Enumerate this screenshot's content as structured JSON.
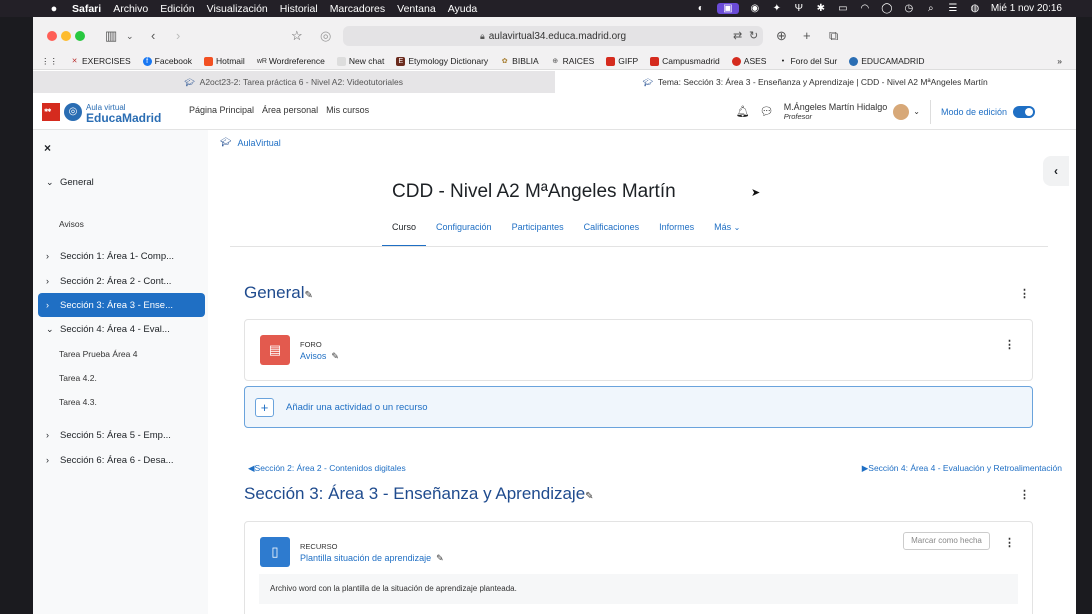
{
  "menubar": {
    "apple": "",
    "items": [
      "Safari",
      "Archivo",
      "Edición",
      "Visualización",
      "Historial",
      "Marcadores",
      "Ventana",
      "Ayuda"
    ],
    "clock": "Mié 1 nov 20:16"
  },
  "browser": {
    "url": "aulavirtual34.educa.madrid.org",
    "bookmarks": [
      "EXERCISES",
      "Facebook",
      "Hotmail",
      "Wordreference",
      "New chat",
      "Etymology Dictionary",
      "BIBLIA",
      "RAICES",
      "GIFP",
      "Campusmadrid",
      "ASES",
      "Foro del Sur",
      "EDUCAMADRID"
    ],
    "tabs": [
      "A2oct23-2: Tarea práctica 6 - Nivel A2: Videotutoriales",
      "Tema: Sección 3: Área 3 - Enseñanza y Aprendizaje | CDD - Nivel A2 MªAngeles Martín"
    ]
  },
  "navbar": {
    "logo_top": "Aula virtual",
    "logo_bottom": "EducaMadrid",
    "links": [
      "Página Principal",
      "Área personal",
      "Mis cursos"
    ],
    "user_name": "M.Ángeles Martín Hidalgo",
    "user_role": "Profesor",
    "edit_mode_label": "Modo de edición",
    "edit_mode_on": true
  },
  "sidebar": {
    "close": "×",
    "general": "General",
    "general_sub": "Avisos",
    "sections": [
      "Sección 1: Área 1- Comp...",
      "Sección 2: Área 2 - Cont...",
      "Sección 3: Área 3 - Ense...",
      "Sección 4: Área 4 - Eval..."
    ],
    "sec4_items": [
      "Tarea Prueba Área 4",
      "Tarea 4.2.",
      "Tarea 4.3."
    ],
    "sections_after": [
      "Sección 5: Área 5 - Emp...",
      "Sección 6: Área 6 - Desa..."
    ]
  },
  "main": {
    "breadcrumb": "AulaVirtual",
    "course_title": "CDD - Nivel A2 MªAngeles Martín",
    "tabs": [
      "Curso",
      "Configuración",
      "Participantes",
      "Calificaciones",
      "Informes",
      "Más"
    ],
    "general_heading": "General",
    "forum": {
      "type": "FORO",
      "name": "Avisos"
    },
    "add_activity": "Añadir una actividad o un recurso",
    "prev_section": "Sección 2: Área 2 - Contenidos digitales",
    "next_section": "Sección 4: Área 4 - Evaluación y Retroalimentación",
    "section3_heading": "Sección 3: Área 3 - Enseñanza y Aprendizaje",
    "resource": {
      "type": "RECURSO",
      "name": "Plantilla situación de aprendizaje",
      "mark_done": "Marcar como hecha",
      "description": "Archivo word con la plantilla de la situación de aprendizaje planteada."
    }
  }
}
